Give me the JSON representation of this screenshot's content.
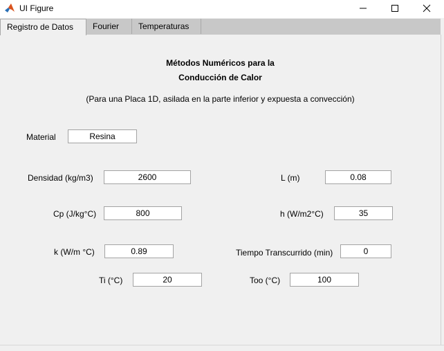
{
  "window": {
    "title": "UI Figure",
    "controls": [
      "minimize-icon",
      "maximize-icon",
      "close-icon"
    ]
  },
  "tabs": [
    {
      "label": "Registro de Datos",
      "active": true
    },
    {
      "label": "Fourier",
      "active": false
    },
    {
      "label": "Temperaturas",
      "active": false
    }
  ],
  "main": {
    "heading_line1": "Métodos Numéricos para la",
    "heading_line2": "Conducción de Calor",
    "subtitle": "(Para una Placa 1D, asilada en la parte inferior y expuesta a convección)"
  },
  "fields": {
    "material": {
      "label": "Material",
      "value": "Resina"
    },
    "densidad": {
      "label": "Densidad (kg/m3)",
      "value": "2600"
    },
    "cp": {
      "label": "Cp (J/kg°C)",
      "value": "800"
    },
    "k": {
      "label": "k (W/m °C)",
      "value": "0.89"
    },
    "ti": {
      "label": "Ti (°C)",
      "value": "20"
    },
    "l": {
      "label": "L (m)",
      "value": "0.08"
    },
    "h": {
      "label": "h (W/m2°C)",
      "value": "35"
    },
    "tiempo": {
      "label": "Tiempo Transcurrido (min)",
      "value": "0"
    },
    "too": {
      "label": "Too (°C)",
      "value": "100"
    }
  },
  "colors": {
    "background": "#f0f0f0",
    "tabstrip": "#c8c8c8",
    "field_border": "#a3a3a3",
    "matlab_icon_orange": "#d9531e",
    "matlab_icon_blue": "#2a6fb5"
  }
}
